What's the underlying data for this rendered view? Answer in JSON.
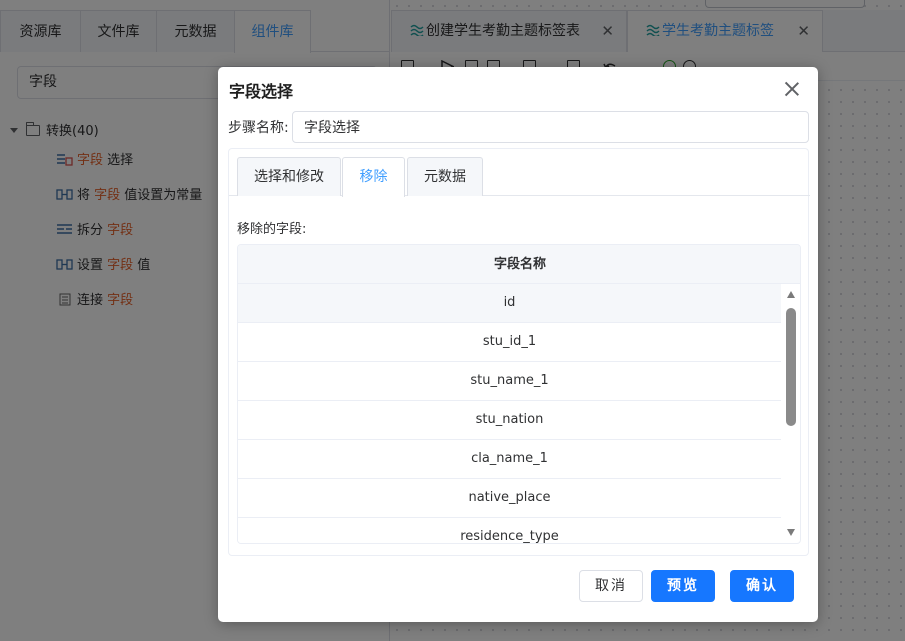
{
  "left_panel": {
    "tabs": [
      "资源库",
      "文件库",
      "元数据",
      "组件库"
    ],
    "active_tab": 3,
    "search_value": "字段",
    "tree": {
      "root_label": "转换(40)",
      "items": [
        {
          "pre": "",
          "hl": "字段",
          "post": " 选择",
          "icon": "field-select-icon"
        },
        {
          "pre": "将 ",
          "hl": "字段",
          "post": " 值设置为常量",
          "icon": "set-constant-icon"
        },
        {
          "pre": "拆分 ",
          "hl": "字段",
          "post": "",
          "icon": "split-field-icon"
        },
        {
          "pre": "设置 ",
          "hl": "字段",
          "post": " 值",
          "icon": "set-value-icon"
        },
        {
          "pre": "连接 ",
          "hl": "字段",
          "post": "",
          "icon": "concat-field-icon"
        }
      ]
    }
  },
  "doc_tabs": [
    {
      "label": "创建学生考勤主题标签表",
      "active": false
    },
    {
      "label": "学生考勤主题标签",
      "active": true
    }
  ],
  "dialog": {
    "title": "字段选择",
    "step_label": "步骤名称:",
    "step_value": "字段选择",
    "tabs": [
      "选择和修改",
      "移除",
      "元数据"
    ],
    "active_tab": 1,
    "removed_label": "移除的字段:",
    "table": {
      "header": "字段名称",
      "rows": [
        "id",
        "stu_id_1",
        "stu_name_1",
        "stu_nation",
        "cla_name_1",
        "native_place",
        "residence_type"
      ]
    },
    "buttons": {
      "cancel": "取消",
      "preview": "预览",
      "ok": "确认"
    }
  },
  "colors": {
    "accent": "#409eff",
    "primary_button": "#1677ff",
    "highlight": "#e6612a"
  }
}
